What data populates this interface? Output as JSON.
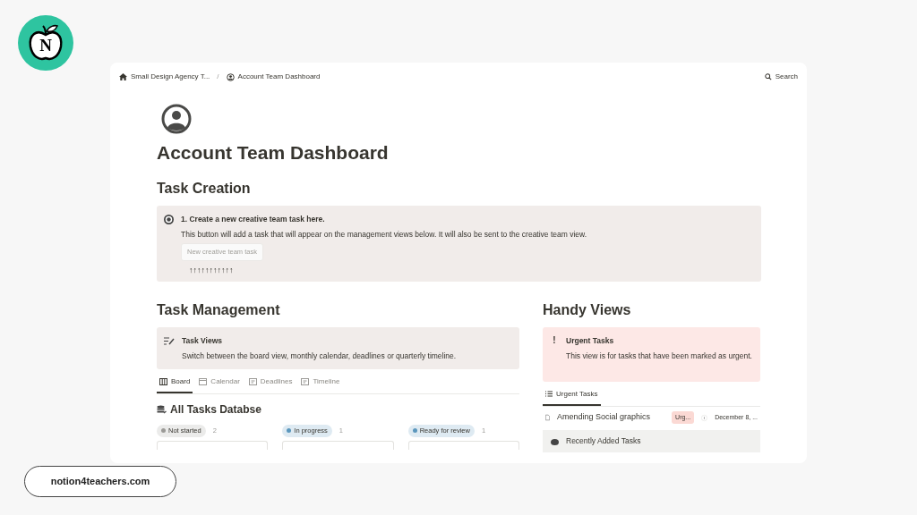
{
  "logo": {
    "letter": "N"
  },
  "breadcrumb": [
    {
      "label": "Small Design Agency T...",
      "kind": "home"
    },
    {
      "label": "Account Team Dashboard",
      "kind": "user"
    }
  ],
  "breadcrumb_separator": "/",
  "search": {
    "label": "Search"
  },
  "page_title": "Account Team Dashboard",
  "task_creation": {
    "heading": "Task Creation",
    "step": "1. Create a new creative team task here.",
    "description": "This button will add a task that will appear on the management views below. It will also be sent to the creative team view.",
    "button": "New creative team task",
    "arrows": "↑↑↑↑↑↑↑↑↑↑↑"
  },
  "task_management": {
    "heading": "Task Management",
    "callout_title": "Task Views",
    "callout_text": "Switch between the board view, monthly calendar, deadlines or quarterly timeline.",
    "tabs": [
      {
        "label": "Board",
        "kind": "board",
        "selected": true
      },
      {
        "label": "Calendar",
        "kind": "calendar",
        "selected": false
      },
      {
        "label": "Deadlines",
        "kind": "table",
        "selected": false
      },
      {
        "label": "Timeline",
        "kind": "table",
        "selected": false
      }
    ],
    "database_title": "All Tasks Databse",
    "groups": [
      {
        "name": "Not started",
        "count": "2",
        "color": "#9b9a97"
      },
      {
        "name": "In progress",
        "count": "1",
        "color": "#5b97bd"
      },
      {
        "name": "Ready for review",
        "count": "1",
        "color": "#5b97bd"
      }
    ]
  },
  "handy_views": {
    "heading": "Handy Views",
    "callout_icon": "!",
    "callout_title": "Urgent Tasks",
    "callout_text": "This view is for tasks that have been marked as urgent.",
    "tabs": [
      {
        "label": "Urgent Tasks",
        "selected": true
      }
    ],
    "rows": [
      {
        "title": "Amending Social graphics",
        "tag": "Urg...",
        "date": "December 8, ..."
      }
    ],
    "next_section": "Recently Added Tasks"
  },
  "footer_link": "notion4teachers.com"
}
